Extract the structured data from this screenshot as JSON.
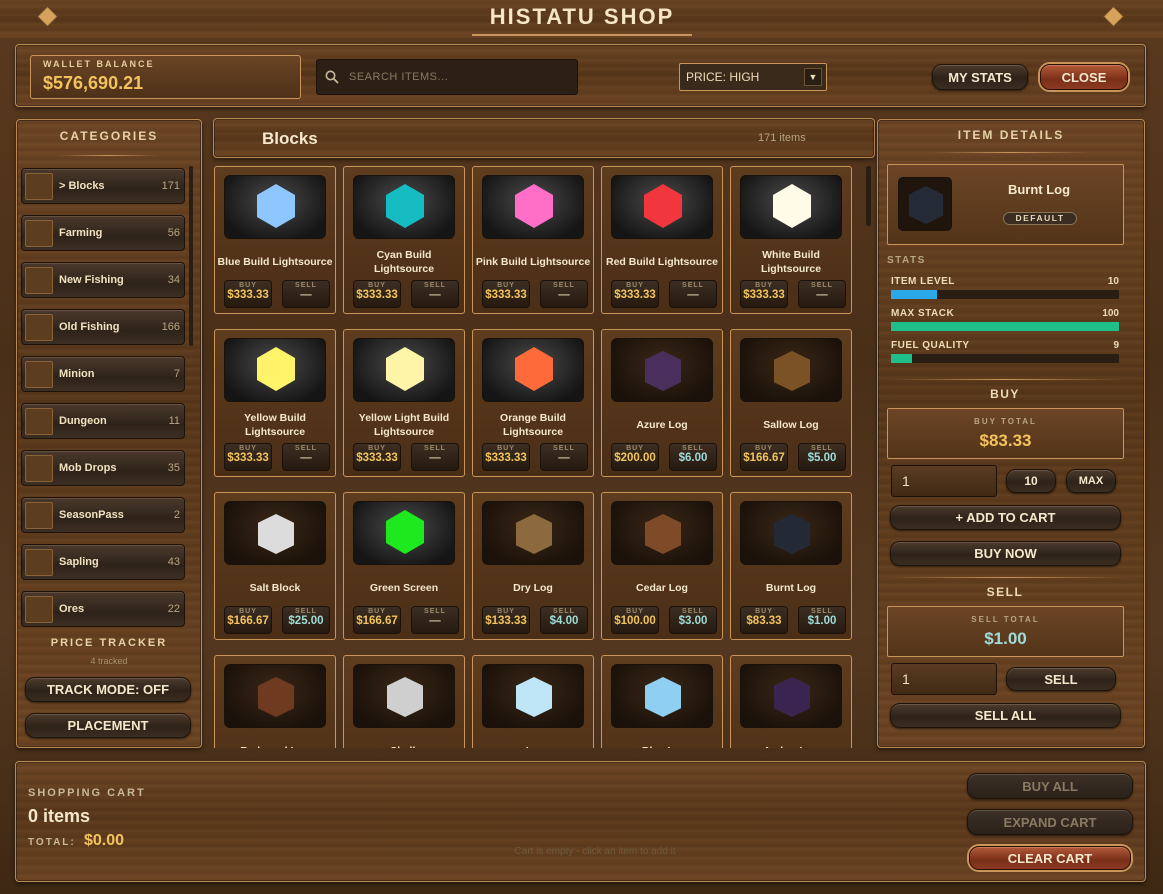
{
  "title": "HISTATU SHOP",
  "wallet": {
    "label": "WALLET BALANCE",
    "value": "$576,690.21"
  },
  "search": {
    "placeholder": "SEARCH ITEMS..."
  },
  "sort": {
    "value": "PRICE: HIGH"
  },
  "header_buttons": {
    "stats": "MY STATS",
    "close": "CLOSE"
  },
  "sidebar": {
    "heading": "CATEGORIES",
    "categories": [
      {
        "label": "> Blocks",
        "count": "171",
        "icon": "blocks-icon"
      },
      {
        "label": "Farming",
        "count": "56",
        "icon": "farming-icon"
      },
      {
        "label": "New Fishing",
        "count": "34",
        "icon": "fish-icon"
      },
      {
        "label": "Old Fishing",
        "count": "166",
        "icon": "fish-icon"
      },
      {
        "label": "Minion",
        "count": "7",
        "icon": "minion-icon"
      },
      {
        "label": "Dungeon",
        "count": "11",
        "icon": "dungeon-icon"
      },
      {
        "label": "Mob Drops",
        "count": "35",
        "icon": "bone-icon"
      },
      {
        "label": "SeasonPass",
        "count": "2",
        "icon": "pass-icon"
      },
      {
        "label": "Sapling",
        "count": "43",
        "icon": "sapling-icon"
      },
      {
        "label": "Ores",
        "count": "22",
        "icon": "ore-icon"
      }
    ],
    "tracker_heading": "PRICE TRACKER",
    "tracker_count": "4 tracked",
    "track_mode": "TRACK MODE: OFF",
    "placement": "PLACEMENT"
  },
  "grid": {
    "heading": "Blocks",
    "count": "171 items",
    "buy_label": "BUY",
    "sell_label": "SELL",
    "items": [
      {
        "name": "Blue Build Lightsource",
        "buy": "$333.33",
        "sell": "—",
        "color": "#8ec7ff",
        "shape": "hex"
      },
      {
        "name": "Cyan Build Lightsource",
        "buy": "$333.33",
        "sell": "—",
        "color": "#17bcc2",
        "shape": "hex"
      },
      {
        "name": "Pink Build Lightsource",
        "buy": "$333.33",
        "sell": "—",
        "color": "#ff6ec7",
        "shape": "hex"
      },
      {
        "name": "Red Build Lightsource",
        "buy": "$333.33",
        "sell": "—",
        "color": "#f2363e",
        "shape": "hex"
      },
      {
        "name": "White Build Lightsource",
        "buy": "$333.33",
        "sell": "—",
        "color": "#fffbe6",
        "shape": "hex"
      },
      {
        "name": "Yellow Build Lightsource",
        "buy": "$333.33",
        "sell": "—",
        "color": "#fff36a",
        "shape": "hex"
      },
      {
        "name": "Yellow Light Build Lightsource",
        "buy": "$333.33",
        "sell": "—",
        "color": "#fff5a8",
        "shape": "hex"
      },
      {
        "name": "Orange Build Lightsource",
        "buy": "$333.33",
        "sell": "—",
        "color": "#ff6a3a",
        "shape": "hex"
      },
      {
        "name": "Azure Log",
        "buy": "$200.00",
        "sell": "$6.00",
        "color": "#4a2f5c",
        "shape": "cube"
      },
      {
        "name": "Sallow Log",
        "buy": "$166.67",
        "sell": "$5.00",
        "color": "#7a5226",
        "shape": "cube"
      },
      {
        "name": "Salt Block",
        "buy": "$166.67",
        "sell": "$25.00",
        "color": "#dcdcdc",
        "shape": "cube"
      },
      {
        "name": "Green Screen",
        "buy": "$166.67",
        "sell": "—",
        "color": "#1ee81e",
        "shape": "hex"
      },
      {
        "name": "Dry Log",
        "buy": "$133.33",
        "sell": "$4.00",
        "color": "#8c6a3e",
        "shape": "cube"
      },
      {
        "name": "Cedar Log",
        "buy": "$100.00",
        "sell": "$3.00",
        "color": "#7e4a28",
        "shape": "cube"
      },
      {
        "name": "Burnt Log",
        "buy": "$83.33",
        "sell": "$1.00",
        "color": "#232a36",
        "shape": "cube"
      },
      {
        "name": "Redwood Log",
        "buy": "",
        "sell": "",
        "color": "#6e3a20",
        "shape": "cube"
      },
      {
        "name": "Chalk",
        "buy": "",
        "sell": "",
        "color": "#cfcfcf",
        "shape": "cube"
      },
      {
        "name": "Ice",
        "buy": "",
        "sell": "",
        "color": "#bfe6f7",
        "shape": "cube"
      },
      {
        "name": "Blue Ice",
        "buy": "",
        "sell": "",
        "color": "#8fd0f2",
        "shape": "cube"
      },
      {
        "name": "Amber Log",
        "buy": "",
        "sell": "",
        "color": "#3a2550",
        "shape": "cube"
      }
    ]
  },
  "details": {
    "heading": "ITEM DETAILS",
    "item_name": "Burnt Log",
    "badge": "DEFAULT",
    "stats_heading": "STATS",
    "stats": [
      {
        "label": "ITEM LEVEL",
        "value": "10",
        "fraction": 0.2,
        "color": "#2aa8e8"
      },
      {
        "label": "MAX STACK",
        "value": "100",
        "fraction": 1.0,
        "color": "#1fbf8a"
      },
      {
        "label": "FUEL QUALITY",
        "value": "9",
        "fraction": 0.09,
        "color": "#1fbf8a"
      }
    ],
    "buy_heading": "BUY",
    "buy_total_label": "BUY TOTAL",
    "buy_total": "$83.33",
    "buy_qty": "1",
    "qty_10": "10",
    "qty_max": "MAX",
    "add_to_cart": "+ ADD TO CART",
    "buy_now": "BUY NOW",
    "sell_heading": "SELL",
    "sell_total_label": "SELL TOTAL",
    "sell_total": "$1.00",
    "sell_qty": "1",
    "sell_button": "SELL",
    "sell_all": "SELL ALL"
  },
  "cart": {
    "heading": "SHOPPING CART",
    "items": "0 items",
    "total_label": "TOTAL:",
    "total": "$0.00",
    "empty_msg": "Cart is empty - click an item to add it",
    "buy_all": "BUY ALL",
    "expand": "EXPAND CART",
    "clear": "CLEAR CART"
  }
}
